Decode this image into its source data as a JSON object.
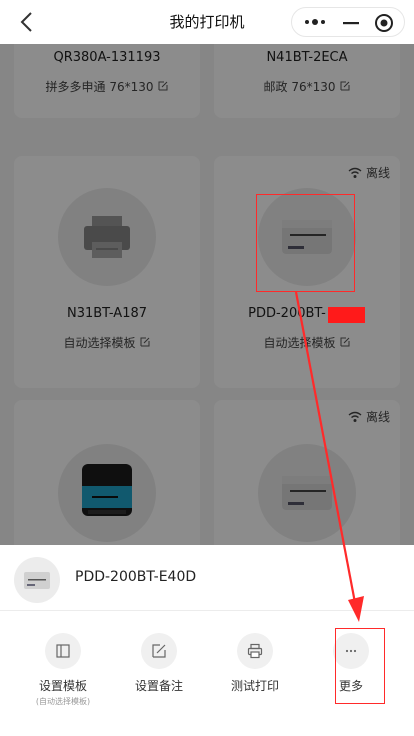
{
  "header": {
    "title": "我的打印机"
  },
  "printers": [
    {
      "model": "QR380A-131193",
      "template": "拼多多申通 76*130"
    },
    {
      "model": "N41BT-2ECA",
      "template": "邮政 76*130"
    },
    {
      "model": "N31BT-A187",
      "template": "自动选择模板"
    },
    {
      "model": "PDD-200BT-",
      "template": "自动选择模板",
      "status": "离线"
    },
    {
      "status": ""
    },
    {
      "status": "离线"
    }
  ],
  "sheet": {
    "device_name": "PDD-200BT-E40D",
    "actions": [
      {
        "label": "设置模板",
        "sub": "(自动选择模板)",
        "icon": "template-icon"
      },
      {
        "label": "设置备注",
        "icon": "edit-icon"
      },
      {
        "label": "测试打印",
        "icon": "printer-icon"
      },
      {
        "label": "更多",
        "icon": "more-icon"
      }
    ]
  },
  "colors": {
    "annotation": "#ff2a2a",
    "overlay": "rgba(0,0,0,0.45)"
  }
}
